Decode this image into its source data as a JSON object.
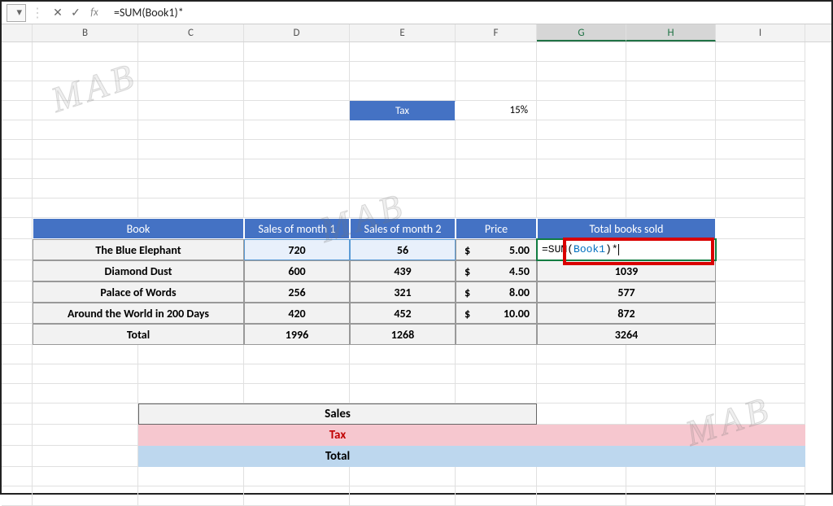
{
  "formula_bar": {
    "namebox_arrow": "▾",
    "cancel": "✕",
    "confirm": "✓",
    "fx": "fx",
    "formula": "=SUM(Book1)*"
  },
  "columns": [
    "B",
    "C",
    "D",
    "E",
    "F",
    "G",
    "H",
    "I"
  ],
  "tax": {
    "label": "Tax",
    "value": "15%"
  },
  "table": {
    "headers": {
      "book": "Book",
      "m1": "Sales of month 1",
      "m2": "Sales of month 2",
      "price": "Price",
      "total": "Total books sold"
    },
    "rows": [
      {
        "book": "The Blue Elephant",
        "m1": "720",
        "m2": "56",
        "price": "5.00",
        "formula_prefix": "=SUM(",
        "formula_book": "Book1",
        "formula_suffix": ")*"
      },
      {
        "book": "Diamond Dust",
        "m1": "600",
        "m2": "439",
        "price": "4.50",
        "total": "1039"
      },
      {
        "book": "Palace of Words",
        "m1": "256",
        "m2": "321",
        "price": "8.00",
        "total": "577"
      },
      {
        "book": "Around the World in 200 Days",
        "m1": "420",
        "m2": "452",
        "price": "10.00",
        "total": "872"
      },
      {
        "book": "Total",
        "m1": "1996",
        "m2": "1268",
        "price": "",
        "total": "3264"
      }
    ],
    "currency": "$"
  },
  "summary": {
    "sales": "Sales",
    "tax": "Tax",
    "total": "Total"
  },
  "watermark": "MAB"
}
